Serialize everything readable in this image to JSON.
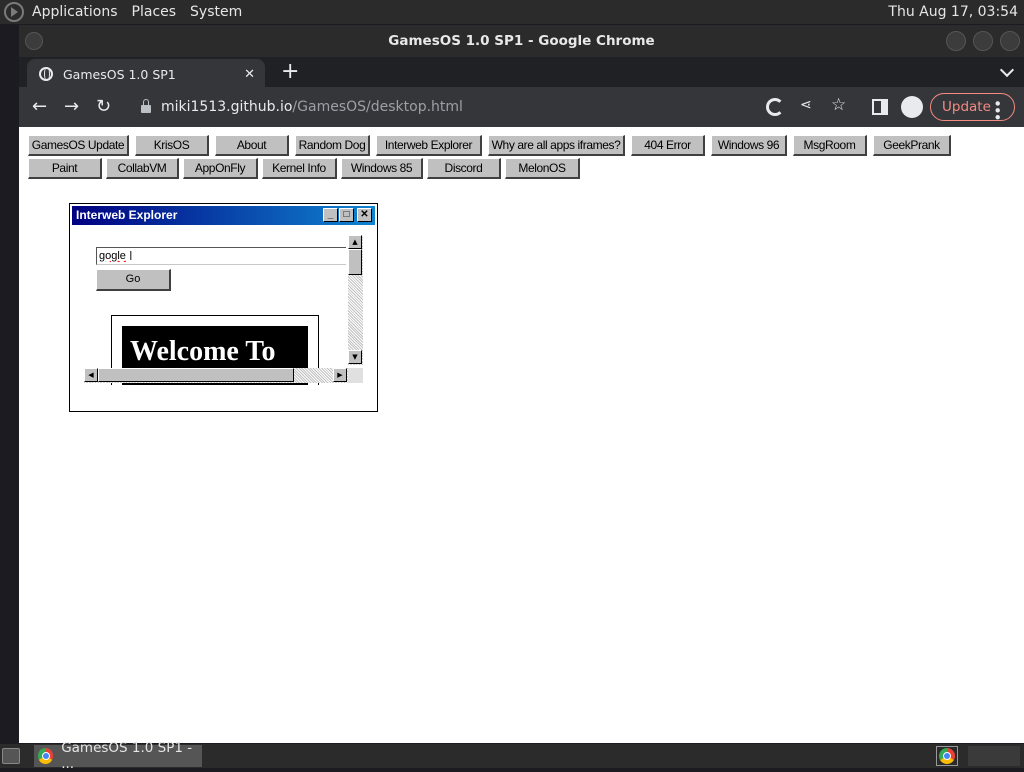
{
  "top_panel": {
    "menus": [
      "Applications",
      "Places",
      "System"
    ],
    "clock": "Thu Aug 17, 03:54"
  },
  "window": {
    "title": "GamesOS 1.0 SP1 - Google Chrome"
  },
  "tab": {
    "title": "GamesOS 1.0 SP1",
    "close": "✕",
    "new_tab": "+"
  },
  "toolbar": {
    "back": "←",
    "forward": "→",
    "reload": "↻",
    "url_host": "miki1513.github.io",
    "url_path": "/GamesOS/desktop.html",
    "share": "⋖",
    "star": "☆",
    "update_label": "Update",
    "menu": "⋮"
  },
  "desktop": {
    "app_buttons_row1": [
      "GamesOS Update",
      "KrisOS",
      "About",
      "Random Dog",
      "Interweb Explorer",
      "Why are all apps iframes?",
      "404 Error",
      "Windows 96",
      "MsgRoom",
      "GeekPrank"
    ],
    "app_buttons_row2": [
      "Paint",
      "CollabVM",
      "AppOnFly",
      "Kernel Info",
      "Windows 85",
      "Discord",
      "MelonOS"
    ]
  },
  "ie_window": {
    "title": "Interweb Explorer",
    "min": "_",
    "max": "□",
    "close": "✕",
    "url_value": "gogle",
    "go_label": "Go",
    "welcome_text": "Welcome To",
    "scroll_up": "▲",
    "scroll_down": "▼",
    "scroll_left": "◀",
    "scroll_right": "▶"
  },
  "taskbar": {
    "task_title": "GamesOS 1.0 SP1 - ..."
  }
}
